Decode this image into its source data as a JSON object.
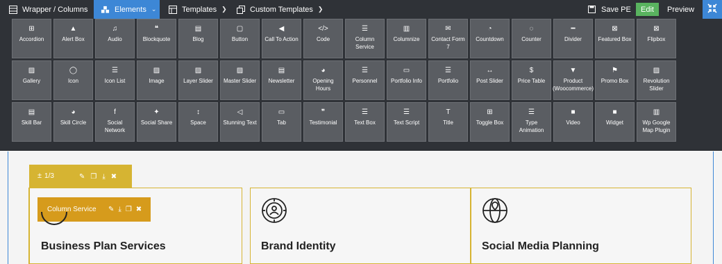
{
  "toolbar": {
    "breadcrumb": "Wrapper / Columns",
    "elements_label": "Elements",
    "templates_label": "Templates",
    "custom_templates_label": "Custom Templates",
    "save_label": "Save PE",
    "edit_label": "Edit",
    "preview_label": "Preview"
  },
  "elements": [
    {
      "label": "Accordion",
      "icon": "plus-square-icon",
      "glyph": "⊞"
    },
    {
      "label": "Alert Box",
      "icon": "warning-icon",
      "glyph": "▲"
    },
    {
      "label": "Audio",
      "icon": "music-icon",
      "glyph": "♫"
    },
    {
      "label": "Blockquote",
      "icon": "quote-icon",
      "glyph": "❝"
    },
    {
      "label": "Blog",
      "icon": "newspaper-icon",
      "glyph": "▤"
    },
    {
      "label": "Button",
      "icon": "square-icon",
      "glyph": "▢"
    },
    {
      "label": "Call To Action",
      "icon": "megaphone-icon",
      "glyph": "◀"
    },
    {
      "label": "Code",
      "icon": "code-icon",
      "glyph": "</>"
    },
    {
      "label": "Column Service",
      "icon": "columns-icon",
      "glyph": "☰"
    },
    {
      "label": "Columnize",
      "icon": "columnize-icon",
      "glyph": "▥"
    },
    {
      "label": "Contact Form 7",
      "icon": "envelope-icon",
      "glyph": "✉"
    },
    {
      "label": "Countdown",
      "icon": "clock-icon",
      "glyph": "◔"
    },
    {
      "label": "Counter",
      "icon": "circle-notch-icon",
      "glyph": "◌"
    },
    {
      "label": "Divider",
      "icon": "minus-icon",
      "glyph": "━"
    },
    {
      "label": "Featured Box",
      "icon": "featured-box-icon",
      "glyph": "⊠"
    },
    {
      "label": "Flipbox",
      "icon": "flipbox-icon",
      "glyph": "⊠"
    },
    {
      "label": "Gallery",
      "icon": "gallery-icon",
      "glyph": "▨"
    },
    {
      "label": "Icon",
      "icon": "lightbulb-icon",
      "glyph": "◯"
    },
    {
      "label": "Icon List",
      "icon": "list-icon",
      "glyph": "☰"
    },
    {
      "label": "Image",
      "icon": "image-icon",
      "glyph": "▨"
    },
    {
      "label": "Layer Slider",
      "icon": "image-icon",
      "glyph": "▨"
    },
    {
      "label": "Master Slider",
      "icon": "image-icon",
      "glyph": "▨"
    },
    {
      "label": "Newsletter",
      "icon": "newsletter-icon",
      "glyph": "▤"
    },
    {
      "label": "Opening Hours",
      "icon": "clock-icon",
      "glyph": "◕"
    },
    {
      "label": "Personnel",
      "icon": "align-right-icon",
      "glyph": "☰"
    },
    {
      "label": "Portfolio Info",
      "icon": "briefcase-icon",
      "glyph": "▭"
    },
    {
      "label": "Portfolio",
      "icon": "list-alt-icon",
      "glyph": "☰"
    },
    {
      "label": "Post Slider",
      "icon": "arrows-h-icon",
      "glyph": "↔"
    },
    {
      "label": "Price Table",
      "icon": "dollar-icon",
      "glyph": "$"
    },
    {
      "label": "Product (Woocommerce)",
      "icon": "cart-icon",
      "glyph": "▼"
    },
    {
      "label": "Promo Box",
      "icon": "bookmark-icon",
      "glyph": "⚑"
    },
    {
      "label": "Revolution Slider",
      "icon": "image-icon",
      "glyph": "▨"
    },
    {
      "label": "Skill Bar",
      "icon": "skill-bar-icon",
      "glyph": "▤"
    },
    {
      "label": "Skill Circle",
      "icon": "pie-chart-icon",
      "glyph": "◕"
    },
    {
      "label": "Social Network",
      "icon": "facebook-icon",
      "glyph": "f"
    },
    {
      "label": "Social Share",
      "icon": "twitter-icon",
      "glyph": "✦"
    },
    {
      "label": "Space",
      "icon": "arrows-v-icon",
      "glyph": "↕"
    },
    {
      "label": "Stunning Text",
      "icon": "volume-icon",
      "glyph": "◁"
    },
    {
      "label": "Tab",
      "icon": "folder-icon",
      "glyph": "▭"
    },
    {
      "label": "Testimonial",
      "icon": "quote-icon",
      "glyph": "❞"
    },
    {
      "label": "Text Box",
      "icon": "align-justify-icon",
      "glyph": "☰"
    },
    {
      "label": "Text Script",
      "icon": "align-justify-icon",
      "glyph": "☰"
    },
    {
      "label": "Title",
      "icon": "text-icon",
      "glyph": "T"
    },
    {
      "label": "Toggle Box",
      "icon": "plus-square-icon",
      "glyph": "⊞"
    },
    {
      "label": "Type Animation",
      "icon": "align-justify-icon",
      "glyph": "☰"
    },
    {
      "label": "Video",
      "icon": "video-icon",
      "glyph": "■"
    },
    {
      "label": "Widget",
      "icon": "widget-icon",
      "glyph": "■"
    },
    {
      "label": "Wp Google Map Plugin",
      "icon": "wp-map-icon",
      "glyph": "▥"
    }
  ],
  "row": {
    "ratio": "1/3"
  },
  "element_toolbar": {
    "title": "Column Service"
  },
  "columns": [
    {
      "title": "Business Plan Services",
      "icon": "target-icon"
    },
    {
      "title": "Brand Identity",
      "icon": "person-badge-icon"
    },
    {
      "title": "Social Media Planning",
      "icon": "globe-pin-icon"
    }
  ],
  "colors": {
    "toolbar_bg": "#2f3237",
    "accent_blue": "#3d87d6",
    "edit_green": "#59b35f",
    "row_gold": "#d6b432",
    "element_orange": "#d69b1c",
    "tile_bg": "#5a5d62"
  }
}
